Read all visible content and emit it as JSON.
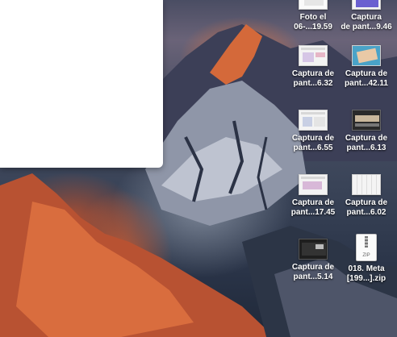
{
  "window": {
    "visible": true
  },
  "desktop": {
    "icons": [
      {
        "label_line1": "Foto el",
        "label_line2": "06-...19.59",
        "kind": "photo"
      },
      {
        "label_line1": "Captura",
        "label_line2": "de pant...9.46",
        "kind": "screenshot"
      },
      {
        "label_line1": "Captura de",
        "label_line2": "pant...6.32",
        "kind": "screenshot"
      },
      {
        "label_line1": "Captura de",
        "label_line2": "pant...42.11",
        "kind": "screenshot"
      },
      {
        "label_line1": "Captura de",
        "label_line2": "pant...6.55",
        "kind": "screenshot"
      },
      {
        "label_line1": "Captura de",
        "label_line2": "pant...6.13",
        "kind": "screenshot"
      },
      {
        "label_line1": "Captura de",
        "label_line2": "pant...17.45",
        "kind": "screenshot"
      },
      {
        "label_line1": "Captura de",
        "label_line2": "pant...6.02",
        "kind": "screenshot"
      },
      {
        "label_line1": "Captura de",
        "label_line2": "pant...5.14",
        "kind": "screenshot"
      },
      {
        "label_line1": "018. Meta",
        "label_line2": "[199...].zip",
        "kind": "zip",
        "badge": "ZIP"
      }
    ]
  },
  "colors": {
    "window_bg": "#ffffff",
    "label_text": "#ffffff",
    "peak_glow": "#e2713c"
  }
}
